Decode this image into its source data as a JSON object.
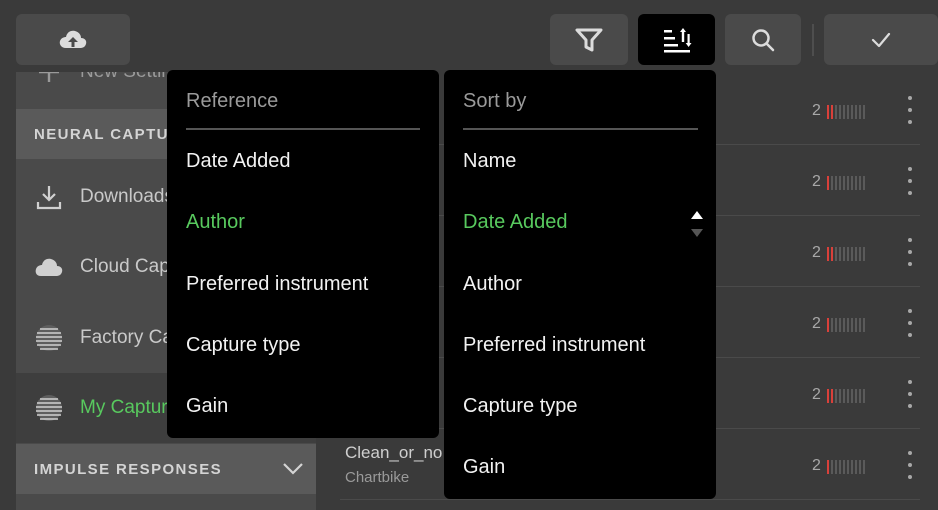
{
  "toolbar": {
    "upload_icon": "cloud-upload-icon",
    "filter_icon": "filter-icon",
    "sort_icon": "sort-icon",
    "search_icon": "search-icon",
    "confirm_icon": "checkmark-icon"
  },
  "sidebar": {
    "top_item_label": "New Settings",
    "neural_capture_header": "NEURAL CAPTURES",
    "items": [
      {
        "label": "Downloads",
        "icon": "download-icon"
      },
      {
        "label": "Cloud Captures",
        "icon": "cloud-icon"
      },
      {
        "label": "Factory Captures",
        "icon": "capture-sphere-icon"
      },
      {
        "label": "My Captures",
        "icon": "capture-sphere-icon"
      }
    ],
    "impulse_header": "IMPULSE RESPONSES"
  },
  "list": {
    "rows": [
      {
        "title": "",
        "sub": "",
        "value": "2"
      },
      {
        "title": "",
        "sub": "",
        "value": "2"
      },
      {
        "title": "",
        "sub": "",
        "value": "2"
      },
      {
        "title": "",
        "sub": "",
        "value": "2"
      },
      {
        "title": "",
        "sub": "",
        "value": "2"
      },
      {
        "title": "Clean_or_no",
        "sub": "Chartbike",
        "value": "2"
      }
    ]
  },
  "reference_menu": {
    "heading": "Reference",
    "options": [
      "Date Added",
      "Author",
      "Preferred instrument",
      "Capture type",
      "Gain"
    ],
    "selected": "Author"
  },
  "sort_menu": {
    "heading": "Sort by",
    "options": [
      "Name",
      "Date Added",
      "Author",
      "Preferred instrument",
      "Capture type",
      "Gain"
    ],
    "selected": "Date Added",
    "direction": "ascending"
  },
  "colors": {
    "accent": "#58c95e",
    "meter_red": "#d9403a",
    "panel_bg": "#000000"
  }
}
